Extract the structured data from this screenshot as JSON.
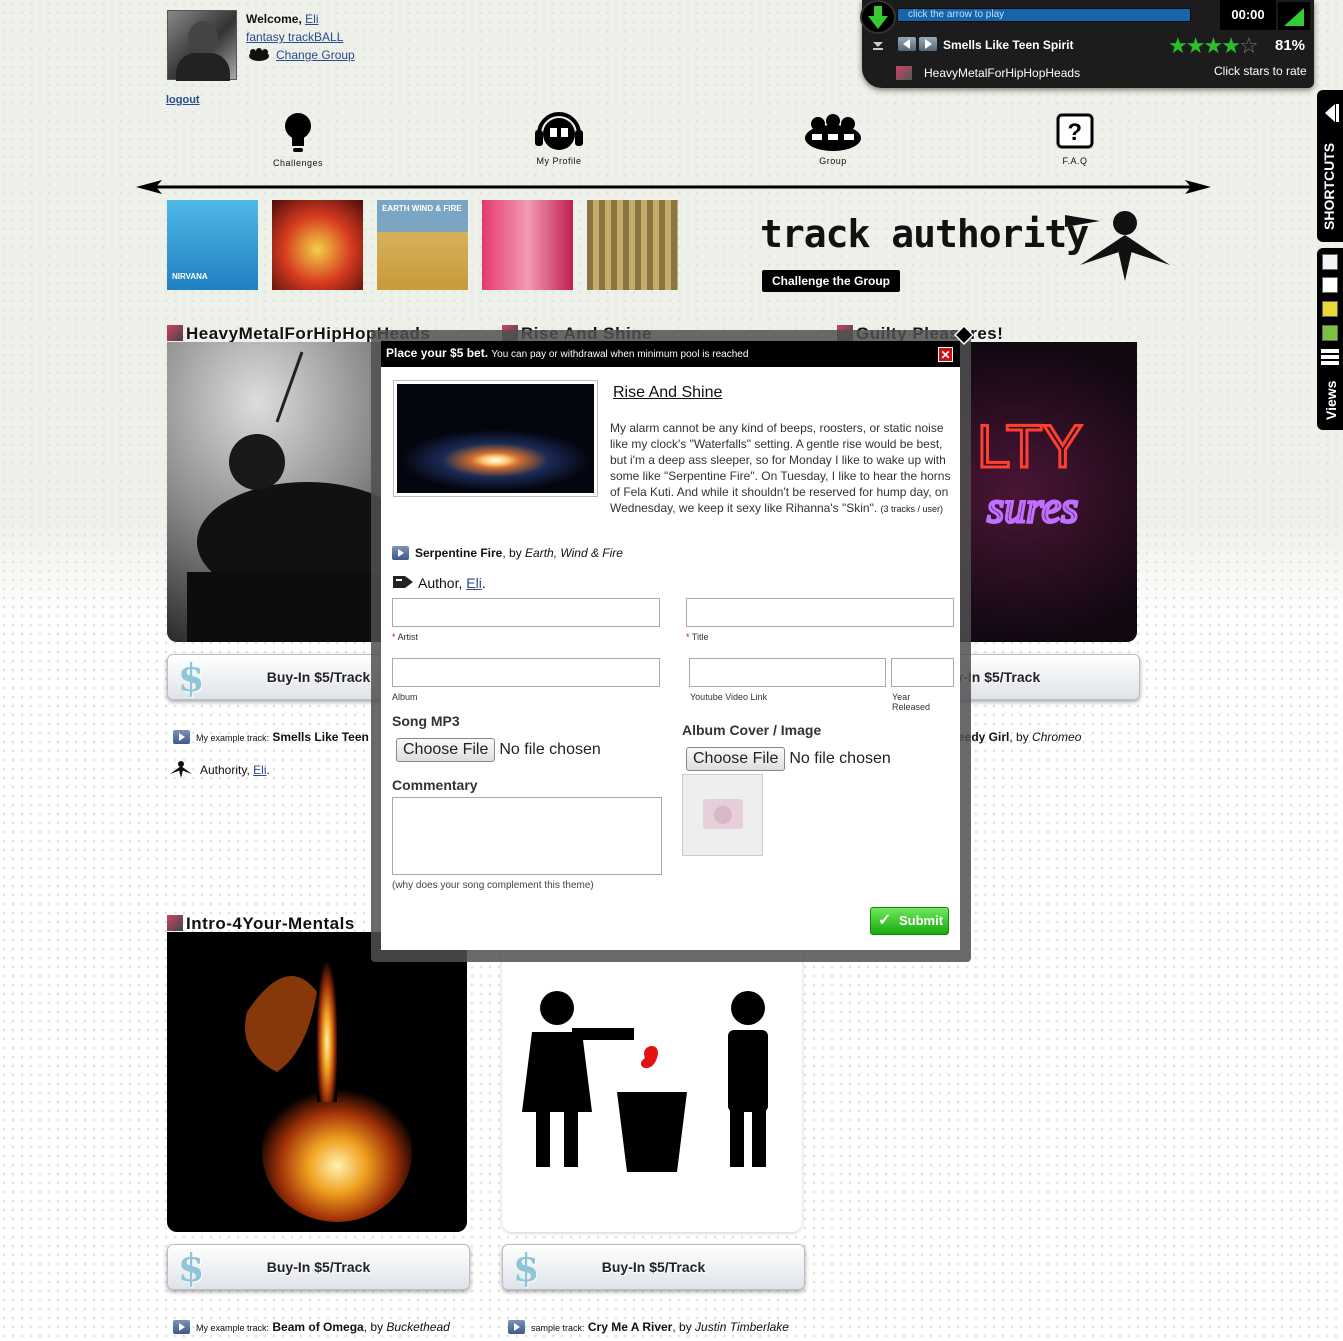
{
  "header": {
    "welcome_label": "Welcome,",
    "user": "Eli",
    "group_name": "fantasy trackBALL",
    "change_group": "Change Group",
    "logout": "logout"
  },
  "nav": {
    "challenges": "Challenges",
    "profile": "My Profile",
    "group": "Group",
    "faq": "F.A.Q"
  },
  "albums": [
    "NIRVANA",
    "",
    "EARTH WIND & FIRE",
    "",
    ""
  ],
  "brand": {
    "logo_text": "track authority",
    "challenge_button": "Challenge the Group"
  },
  "player": {
    "progress_hint": "click the arrow to play",
    "time": "00:00",
    "track": "Smells Like Teen Spirit",
    "rating_stars": 4,
    "rating_pct": "81%",
    "group": "HeavyMetalForHipHopHeads",
    "rate_hint": "Click stars to rate"
  },
  "side": {
    "shortcuts": "SHORTCUTS",
    "views": "Views",
    "swatch_colors": [
      "#ffffff",
      "#e8d935",
      "#7cc040"
    ]
  },
  "groups": [
    {
      "title": "HeavyMetalForHipHopHeads",
      "buyin": "Buy-In $5/Track",
      "track_prefix": "My example track:",
      "track": "Smells Like Teen",
      "artist": "",
      "author_label": "Authority,",
      "author": "Eli"
    },
    {
      "title": "Rise And Shine"
    },
    {
      "title": "Guilty Pleasures!",
      "buyin": "Buy-In $5/Track",
      "track": "eedy Girl",
      "artist": "Chromeo"
    },
    {
      "title": "Intro-4Your-Mentals",
      "buyin": "Buy-In $5/Track",
      "track_prefix": "My example track:",
      "track": "Beam of Omega",
      "artist": "Buckethead"
    },
    {
      "title": "",
      "buyin": "Buy-In $5/Track",
      "track_prefix": "sample track:",
      "track": "Cry Me A River",
      "artist": "Justin Timberlake"
    }
  ],
  "modal": {
    "title": "Place your $5 bet.",
    "subtitle": "You can pay or withdrawal when minimum pool is reached",
    "close": "✕",
    "theme_title": "Rise And Shine",
    "theme_desc": "My alarm cannot be any kind of beeps, roosters, or static noise like my clock's \"Waterfalls\" setting. A gentle rise would be best, but i'm a deep ass sleeper, so for Monday I like to wake up with some like \"Serpentine Fire\". On Tuesday, I like to hear the horns of Fela Kuti. And while it shouldn't be reserved for hump day, on Wednesday, we keep it sexy like Rihanna's \"Skin\".",
    "theme_note": "(3 tracks / user)",
    "selected_track": "Serpentine Fire",
    "selected_by": ", by",
    "selected_artist": "Earth, Wind & Fire",
    "author_label": "Author,",
    "author": "Eli",
    "author_end": ".",
    "artist_label": "Artist",
    "title_label": "Title",
    "album_label": "Album",
    "youtube_label": "Youtube Video Link",
    "year_label": "Year Released",
    "song_mp3": "Song MP3",
    "album_cover": "Album Cover / Image",
    "choose_file": "Choose File",
    "no_file": "No file chosen",
    "commentary": "Commentary",
    "commentary_hint": "(why does your song complement this theme)",
    "submit": "Submit"
  }
}
